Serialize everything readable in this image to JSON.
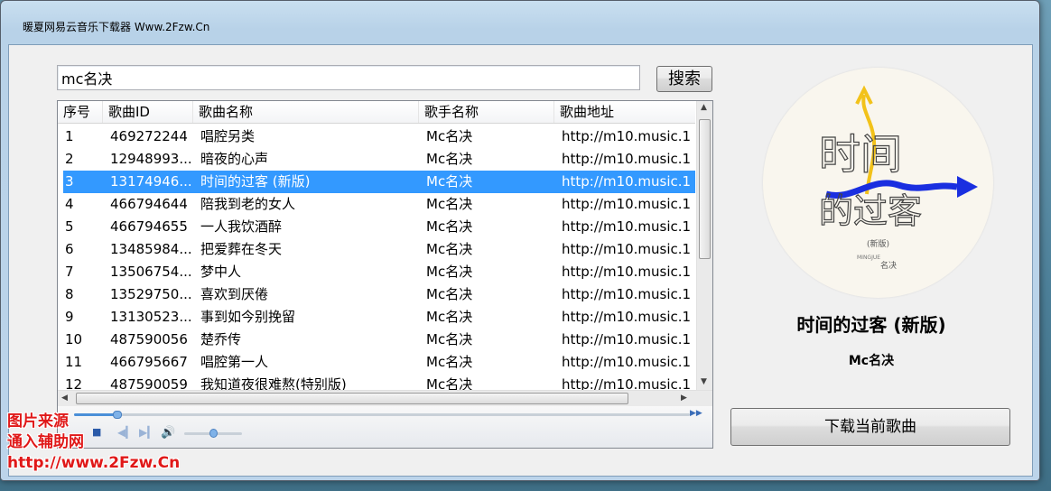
{
  "window": {
    "title": "暖夏网易云音乐下载器 Www.2Fzw.Cn"
  },
  "search": {
    "value": "mc名决",
    "button_label": "搜索"
  },
  "table": {
    "columns": [
      "序号",
      "歌曲ID",
      "歌曲名称",
      "歌手名称",
      "歌曲地址"
    ],
    "selected_index": 2,
    "rows": [
      [
        "1",
        "469272244",
        "唱腔另类",
        "Mc名决",
        "http://m10.music.1"
      ],
      [
        "2",
        "12948993...",
        "暗夜的心声",
        "Mc名决",
        "http://m10.music.1"
      ],
      [
        "3",
        "13174946...",
        "时间的过客 (新版)",
        "Mc名决",
        "http://m10.music.1"
      ],
      [
        "4",
        "466794644",
        "陪我到老的女人",
        "Mc名决",
        "http://m10.music.1"
      ],
      [
        "5",
        "466794655",
        "一人我饮酒醉",
        "Mc名决",
        "http://m10.music.1"
      ],
      [
        "6",
        "13485984...",
        "把爱葬在冬天",
        "Mc名决",
        "http://m10.music.1"
      ],
      [
        "7",
        "13506754...",
        "梦中人",
        "Mc名决",
        "http://m10.music.1"
      ],
      [
        "8",
        "13529750...",
        "喜欢到厌倦",
        "Mc名决",
        "http://m10.music.1"
      ],
      [
        "9",
        "13130523...",
        "事到如今别挽留",
        "Mc名决",
        "http://m10.music.1"
      ],
      [
        "10",
        "487590056",
        "楚乔传",
        "Mc名决",
        "http://m10.music.1"
      ],
      [
        "11",
        "466795667",
        "唱腔第一人",
        "Mc名决",
        "http://m10.music.1"
      ],
      [
        "12",
        "487590059",
        "我知道夜很难熬(特别版)",
        "Mc名决",
        "http://m10.music.1"
      ]
    ]
  },
  "player": {
    "seek_progress": 0.07,
    "volume": 0.5
  },
  "now_playing": {
    "cover_text_line1": "时间",
    "cover_text_line2": "的过客",
    "cover_sub": "(新版)",
    "cover_artist": "名决",
    "cover_latin": "MINGJUE",
    "title": "时间的过客 (新版)",
    "artist": "Mc名决"
  },
  "download_button_label": "下载当前歌曲",
  "watermark": {
    "line1": "图片来源",
    "line2": "通入辅助网",
    "line3": "http://www.2Fzw.Cn"
  },
  "colors": {
    "selection": "#3399ff",
    "watermark": "#e01818",
    "cover_blue": "#1a2fe0",
    "cover_yellow": "#f2c21a"
  }
}
